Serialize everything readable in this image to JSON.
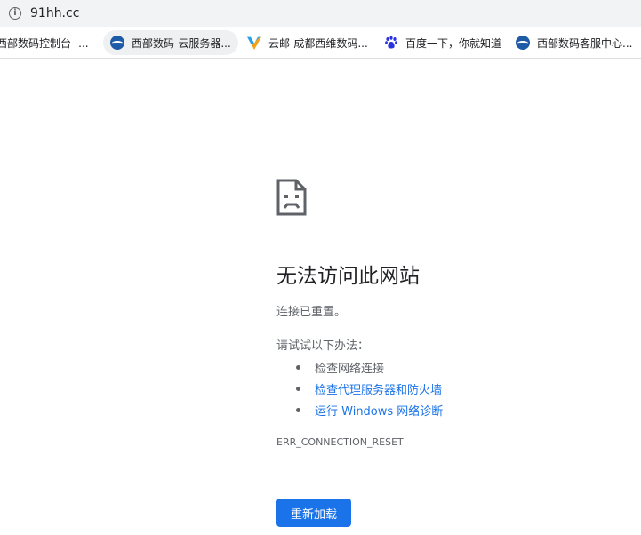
{
  "browser": {
    "url": "91hh.cc",
    "bookmarks": [
      {
        "label": "西部数码控制台 -...",
        "icon": "west-digital-favicon"
      },
      {
        "label": "西部数码-云服务器...",
        "icon": "west-digital-favicon"
      },
      {
        "label": "云邮-成都西维数码...",
        "icon": "yunmail-favicon"
      },
      {
        "label": "百度一下，你就知道",
        "icon": "baidu-paw-favicon"
      },
      {
        "label": "西部数码客服中心...",
        "icon": "west-digital-favicon"
      }
    ]
  },
  "error_page": {
    "icon": "sad-page-icon",
    "title": "无法访问此网站",
    "subtitle": "连接已重置。",
    "try_label": "请试试以下办法：",
    "suggestions": [
      {
        "label": "检查网络连接",
        "is_link": false
      },
      {
        "label": "检查代理服务器和防火墙",
        "is_link": true
      },
      {
        "label": "运行 Windows 网络诊断",
        "is_link": true
      }
    ],
    "error_code": "ERR_CONNECTION_RESET",
    "reload_label": "重新加载"
  },
  "colors": {
    "accent": "#1a73e8",
    "text_primary": "#202124",
    "text_secondary": "#5f6368",
    "toolbar_bg": "#f1f3f4"
  }
}
